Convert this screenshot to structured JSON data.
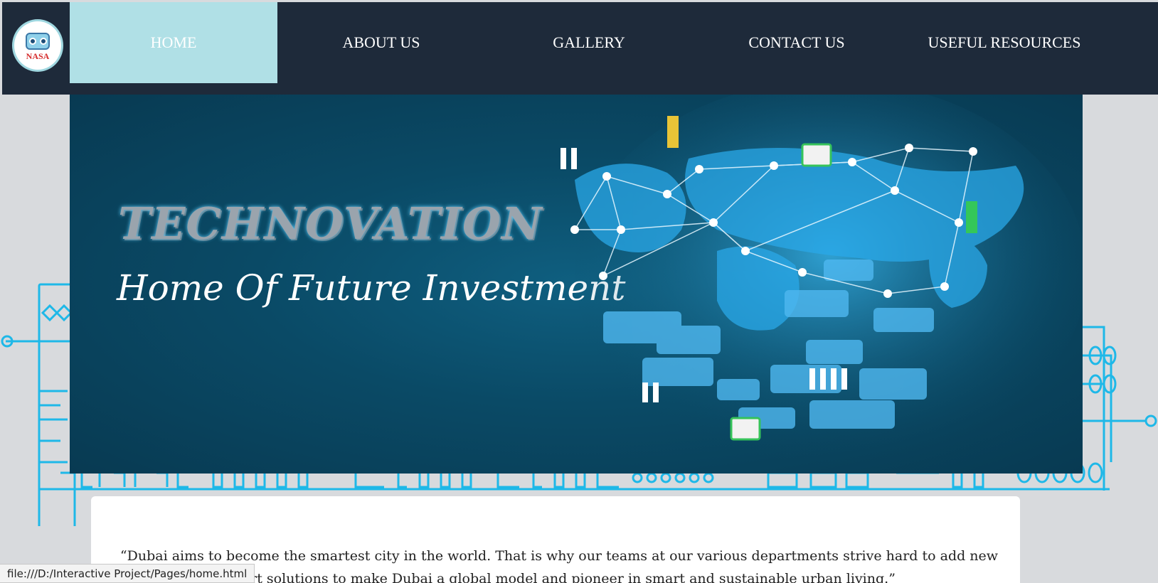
{
  "logo": {
    "text": "NASA"
  },
  "nav": {
    "items": [
      {
        "label": "HOME",
        "active": true
      },
      {
        "label": "ABOUT US",
        "active": false
      },
      {
        "label": "GALLERY",
        "active": false
      },
      {
        "label": "CONTACT US",
        "active": false
      },
      {
        "label": "USEFUL RESOURCES",
        "active": false
      }
    ]
  },
  "hero": {
    "title": "TECHNOVATION",
    "subtitle": "Home Of Future Investment"
  },
  "content": {
    "quote": "“Dubai aims to become the smartest city in the world. That is why our teams at our various departments strive hard to add new smart solutions to make Dubai a global model and pioneer in smart and sustainable urban living.”"
  },
  "status_bar": {
    "url": "file:///D:/Interactive Project/Pages/home.html"
  },
  "colors": {
    "nav_bg": "#1e2a3a",
    "nav_active": "#b0e0e6",
    "page_bg": "#d8dadd",
    "circuit": "#1eb8e8"
  }
}
